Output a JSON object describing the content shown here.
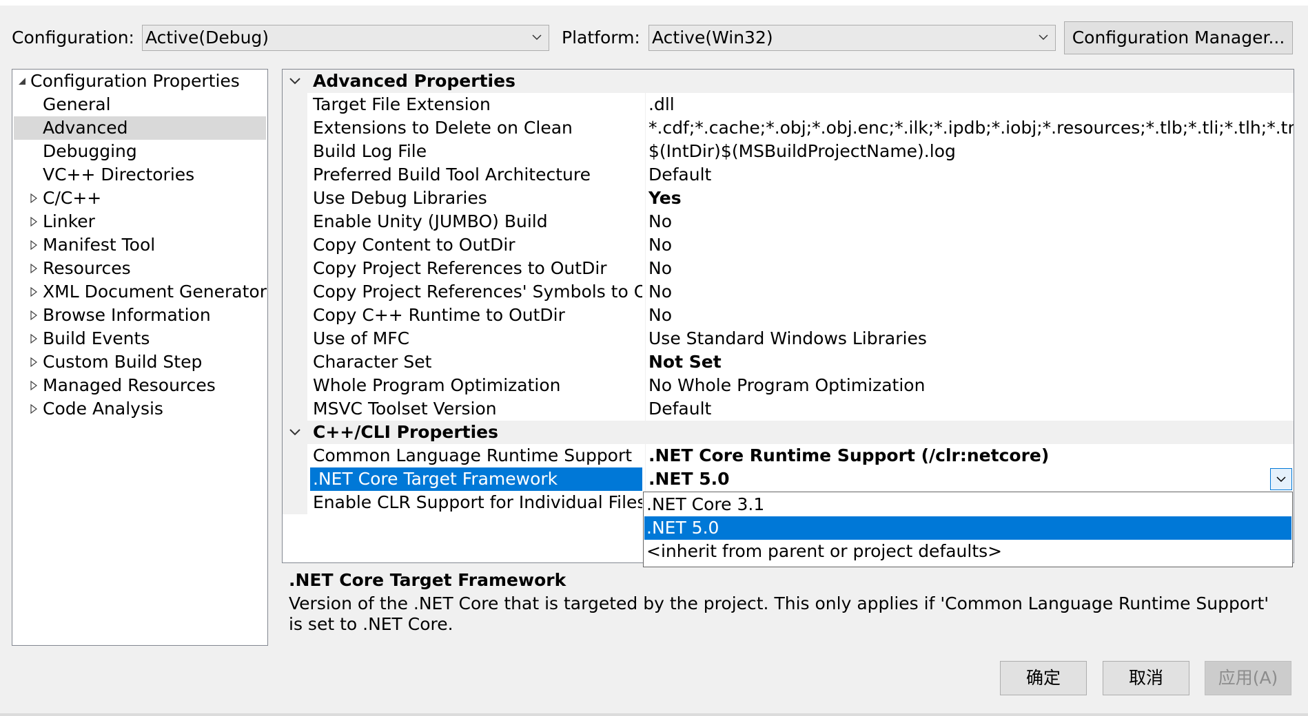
{
  "header": {
    "configuration_label": "Configuration:",
    "configuration_value": "Active(Debug)",
    "platform_label": "Platform:",
    "platform_value": "Active(Win32)",
    "config_manager_button": "Configuration Manager..."
  },
  "tree": {
    "root": "Configuration Properties",
    "items": [
      {
        "label": "General",
        "expandable": false
      },
      {
        "label": "Advanced",
        "expandable": false,
        "selected": true
      },
      {
        "label": "Debugging",
        "expandable": false
      },
      {
        "label": "VC++ Directories",
        "expandable": false
      },
      {
        "label": "C/C++",
        "expandable": true
      },
      {
        "label": "Linker",
        "expandable": true
      },
      {
        "label": "Manifest Tool",
        "expandable": true
      },
      {
        "label": "Resources",
        "expandable": true
      },
      {
        "label": "XML Document Generator",
        "expandable": true
      },
      {
        "label": "Browse Information",
        "expandable": true
      },
      {
        "label": "Build Events",
        "expandable": true
      },
      {
        "label": "Custom Build Step",
        "expandable": true
      },
      {
        "label": "Managed Resources",
        "expandable": true
      },
      {
        "label": "Code Analysis",
        "expandable": true
      }
    ]
  },
  "grid": {
    "categories": [
      {
        "name": "Advanced Properties",
        "properties": [
          {
            "name": "Target File Extension",
            "value": ".dll",
            "bold": false
          },
          {
            "name": "Extensions to Delete on Clean",
            "value": "*.cdf;*.cache;*.obj;*.obj.enc;*.ilk;*.ipdb;*.iobj;*.resources;*.tlb;*.tli;*.tlh;*.tmp;*.rsp;*.p",
            "bold": false
          },
          {
            "name": "Build Log File",
            "value": "$(IntDir)$(MSBuildProjectName).log",
            "bold": false
          },
          {
            "name": "Preferred Build Tool Architecture",
            "value": "Default",
            "bold": false
          },
          {
            "name": "Use Debug Libraries",
            "value": "Yes",
            "bold": true
          },
          {
            "name": "Enable Unity (JUMBO) Build",
            "value": "No",
            "bold": false
          },
          {
            "name": "Copy Content to OutDir",
            "value": "No",
            "bold": false
          },
          {
            "name": "Copy Project References to OutDir",
            "value": "No",
            "bold": false
          },
          {
            "name": "Copy Project References' Symbols to OutD",
            "value": "No",
            "bold": false
          },
          {
            "name": "Copy C++ Runtime to OutDir",
            "value": "No",
            "bold": false
          },
          {
            "name": "Use of MFC",
            "value": "Use Standard Windows Libraries",
            "bold": false
          },
          {
            "name": "Character Set",
            "value": "Not Set",
            "bold": true
          },
          {
            "name": "Whole Program Optimization",
            "value": "No Whole Program Optimization",
            "bold": false
          },
          {
            "name": "MSVC Toolset Version",
            "value": "Default",
            "bold": false
          }
        ]
      },
      {
        "name": "C++/CLI Properties",
        "properties": [
          {
            "name": "Common Language Runtime Support",
            "value": ".NET Core Runtime Support (/clr:netcore)",
            "bold": true
          },
          {
            "name": ".NET Core Target Framework",
            "value": ".NET 5.0",
            "bold": true,
            "selected": true
          },
          {
            "name": "Enable CLR Support for Individual Files",
            "value": "",
            "bold": false
          }
        ]
      }
    ],
    "dropdown_options": [
      ".NET Core 3.1",
      ".NET 5.0",
      "<inherit from parent or project defaults>"
    ],
    "dropdown_selected": ".NET 5.0"
  },
  "description": {
    "title": ".NET Core Target Framework",
    "text": "Version of the .NET Core that is targeted by the project. This only applies if 'Common Language Runtime Support' is set to .NET Core."
  },
  "buttons": {
    "ok": "确定",
    "cancel": "取消",
    "apply": "应用(A)"
  },
  "colors": {
    "selection": "#0078d7",
    "tree_selection": "#d9d9d9",
    "window_bg": "#f0f0f0"
  }
}
